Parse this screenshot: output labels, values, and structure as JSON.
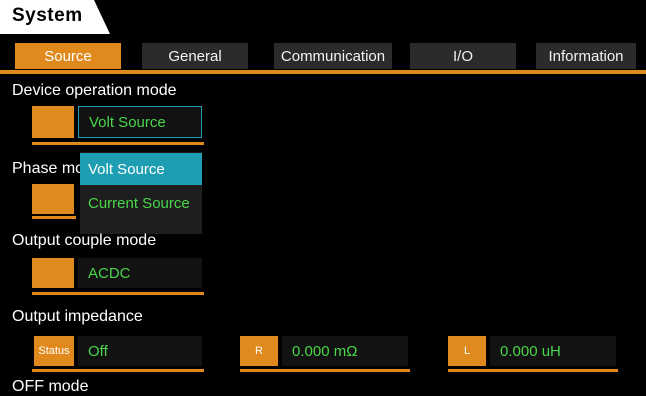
{
  "window": {
    "title": "System"
  },
  "tabs": [
    {
      "label": "Source",
      "active": true
    },
    {
      "label": "General",
      "active": false
    },
    {
      "label": "Communication",
      "active": false
    },
    {
      "label": "I/O",
      "active": false
    },
    {
      "label": "Information",
      "active": false
    }
  ],
  "device_operation_mode": {
    "label": "Device operation mode",
    "value": "Volt Source",
    "options": [
      "Volt Source",
      "Current Source"
    ],
    "selected_option": "Volt Source"
  },
  "phase_mode": {
    "label": "Phase mo"
  },
  "output_couple_mode": {
    "label": "Output couple mode",
    "value": "ACDC"
  },
  "output_impedance": {
    "label": "Output impedance",
    "status_tag": "Status",
    "status_value": "Off",
    "r_tag": "R",
    "r_value": "0.000 mΩ",
    "l_tag": "L",
    "l_value": "0.000 uH"
  },
  "off_mode": {
    "label": "OFF mode"
  },
  "colors": {
    "accent": "#e08a1e",
    "value_text": "#49d64a",
    "selected": "#1e9eb3",
    "background": "#000000"
  }
}
